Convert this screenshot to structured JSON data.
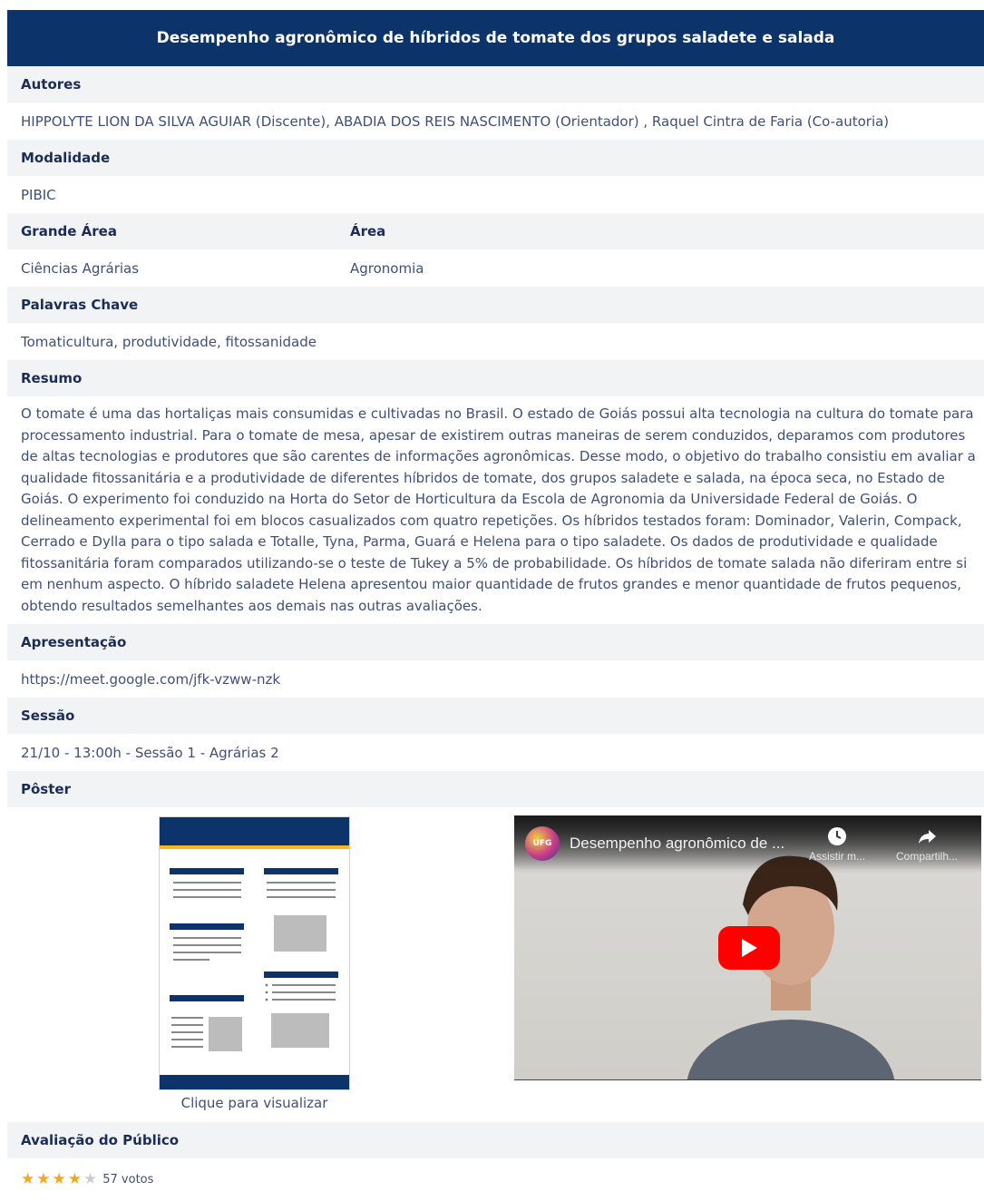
{
  "title": "Desempenho agronômico de híbridos de tomate dos grupos saladete e salada",
  "autores": {
    "label": "Autores",
    "value": "HIPPOLYTE LION DA SILVA AGUIAR (Discente), ABADIA DOS REIS NASCIMENTO (Orientador) , Raquel Cintra de Faria (Co-autoria)"
  },
  "modalidade": {
    "label": "Modalidade",
    "value": "PIBIC"
  },
  "grande_area": {
    "label": "Grande Área",
    "value": "Ciências Agrárias"
  },
  "area": {
    "label": "Área",
    "value": "Agronomia"
  },
  "palavras_chave": {
    "label": "Palavras Chave",
    "value": "Tomaticultura, produtividade, fitossanidade"
  },
  "resumo": {
    "label": "Resumo",
    "value": "O tomate é uma das hortaliças mais consumidas e cultivadas no Brasil. O estado de Goiás possui alta tecnologia na cultura do tomate para processamento industrial. Para o tomate de mesa, apesar de existirem outras maneiras de serem conduzidos, deparamos com produtores de altas tecnologias e produtores que são carentes de informações agronômicas. Desse modo, o objetivo do trabalho consistiu em avaliar a qualidade fitossanitária e a produtividade de diferentes híbridos de tomate, dos grupos saladete e salada, na época seca, no Estado de Goiás. O experimento foi conduzido na Horta do Setor de Horticultura da Escola de Agronomia da Universidade Federal de Goiás. O delineamento experimental foi em blocos casualizados com quatro repetições. Os híbridos testados foram: Dominador, Valerin, Compack, Cerrado e Dylla para o tipo salada e Totalle, Tyna, Parma, Guará e Helena para o tipo saladete. Os dados de produtividade e qualidade fitossanitária foram comparados utilizando-se o teste de Tukey a 5% de probabilidade. Os híbridos de tomate salada não diferiram entre si em nenhum aspecto. O híbrido saladete Helena apresentou maior quantidade de frutos grandes e menor quantidade de frutos pequenos, obtendo resultados semelhantes aos demais nas outras avaliações."
  },
  "apresentacao": {
    "label": "Apresentação",
    "value": "https://meet.google.com/jfk-vzww-nzk"
  },
  "sessao": {
    "label": "Sessão",
    "value": "21/10 - 13:00h - Sessão 1 - Agrárias 2"
  },
  "poster": {
    "label": "Pôster",
    "caption": "Clique para visualizar"
  },
  "video": {
    "title": "Desempenho agronômico de ...",
    "watch_later": "Assistir m...",
    "share": "Compartilh...",
    "channel_logo": "UFG"
  },
  "avaliacao": {
    "label": "Avaliação do Público",
    "rating": 4,
    "max_rating": 5,
    "votes": "57 votos"
  },
  "colors": {
    "brand_navy": "#0c336a",
    "accent_yellow": "#f4b820",
    "star_filled": "#f5a623",
    "star_empty": "#c9cdd3",
    "youtube_red": "#ff0000"
  }
}
